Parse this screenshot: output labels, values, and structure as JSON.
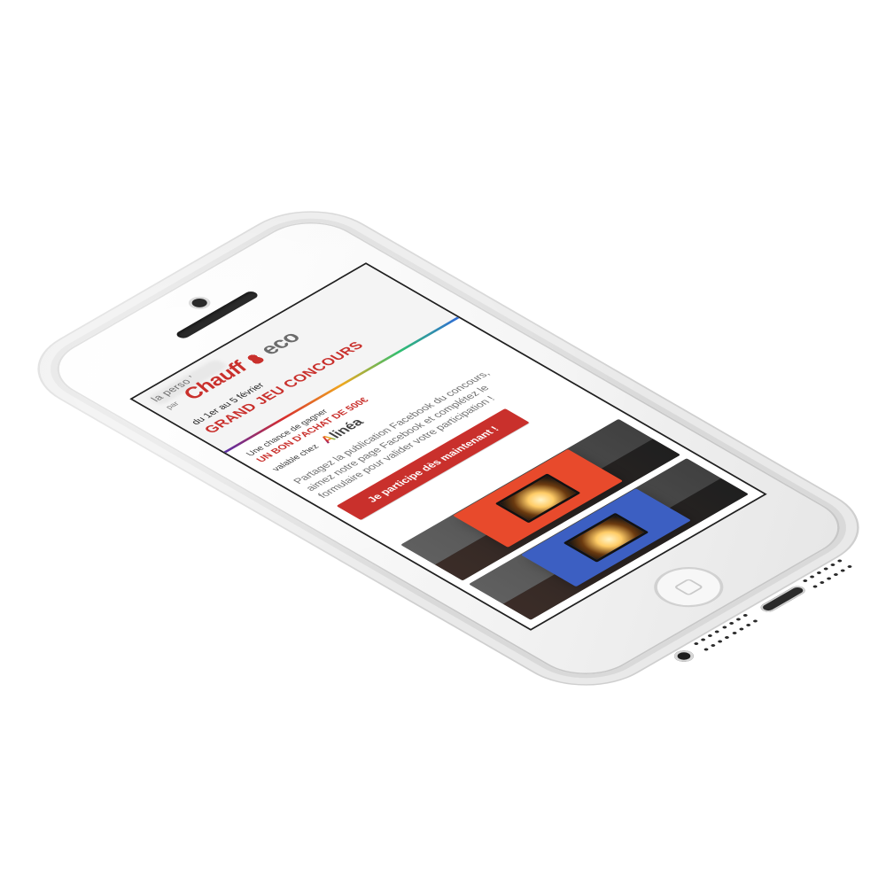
{
  "header": {
    "brand_prefix": "la perso ’",
    "brand_par": "par",
    "brand_name_main": "Chauff",
    "brand_name_suffix": "eco",
    "date_range": "du 1er au 5 février",
    "contest_title": "GRAND JEU CONCOURS"
  },
  "promo": {
    "chance_text": "Une chance de gagner",
    "voucher_text": "UN BON D'ACHAT DE 500€",
    "valid_text": "valable chez",
    "partner_name": "Alinéa"
  },
  "description": "Partagez la publication Facebook du concours, aimez notre page Facebook et complétez le formulaire pour valider votre participation !",
  "cta": {
    "label": "Je participe dès maintenant !"
  },
  "colors": {
    "accent_red": "#c9302c",
    "text_dark": "#1f1f1f",
    "text_muted": "#6f6f6f"
  },
  "icons": {
    "brand_flame": "flame-icon",
    "home_button": "home-button-icon"
  }
}
